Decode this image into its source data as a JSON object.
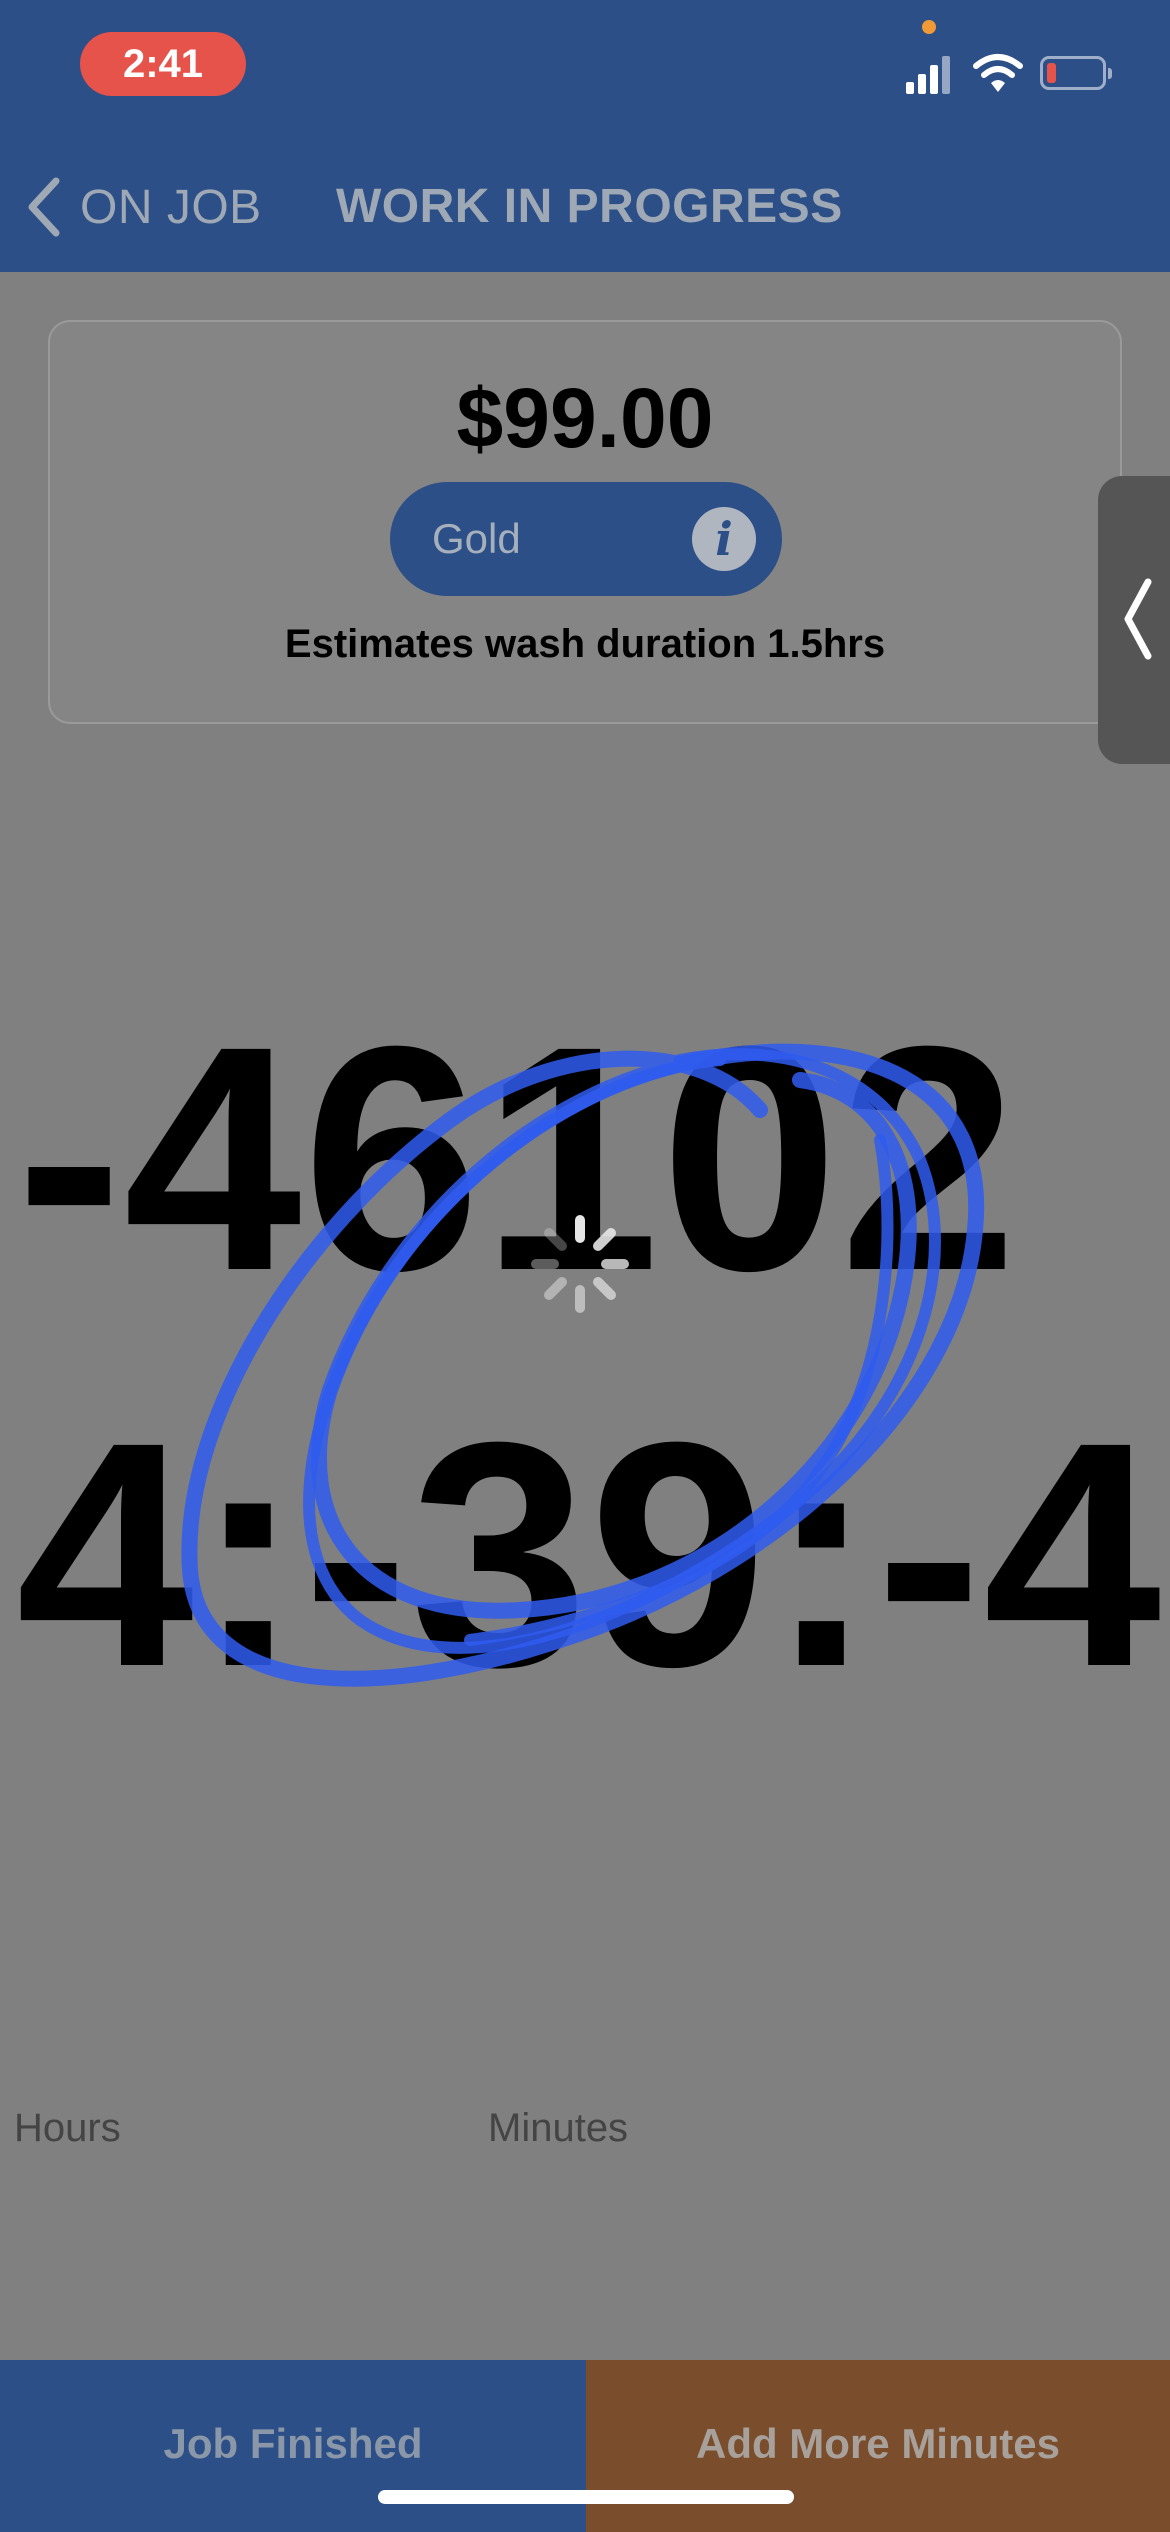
{
  "status_bar": {
    "time": "2:41"
  },
  "nav": {
    "back_label": "ON JOB",
    "title": "WORK IN PROGRESS"
  },
  "summary": {
    "price": "$99.00",
    "package": "Gold",
    "info_glyph": "i",
    "estimate": "Estimates wash duration 1.5hrs"
  },
  "timer": {
    "value": "-461024:-39:-4",
    "hours_label": "Hours",
    "minutes_label": "Minutes"
  },
  "actions": {
    "finish_label": "Job Finished",
    "add_minutes_label": "Add More Minutes"
  },
  "colors": {
    "header_bg": "#2d4f87",
    "page_bg": "#808080",
    "time_pill": "#e5534b",
    "finish_button": "#2d4f87",
    "add_minutes_button": "#7a4e2c",
    "scribble": "#2f5cf0"
  },
  "icons": {
    "back": "chevron-left-icon",
    "info": "info-icon",
    "drawer": "chevron-left-icon",
    "loading": "spinner-icon",
    "signal": "cellular-signal-icon",
    "wifi": "wifi-icon",
    "battery": "battery-icon"
  }
}
